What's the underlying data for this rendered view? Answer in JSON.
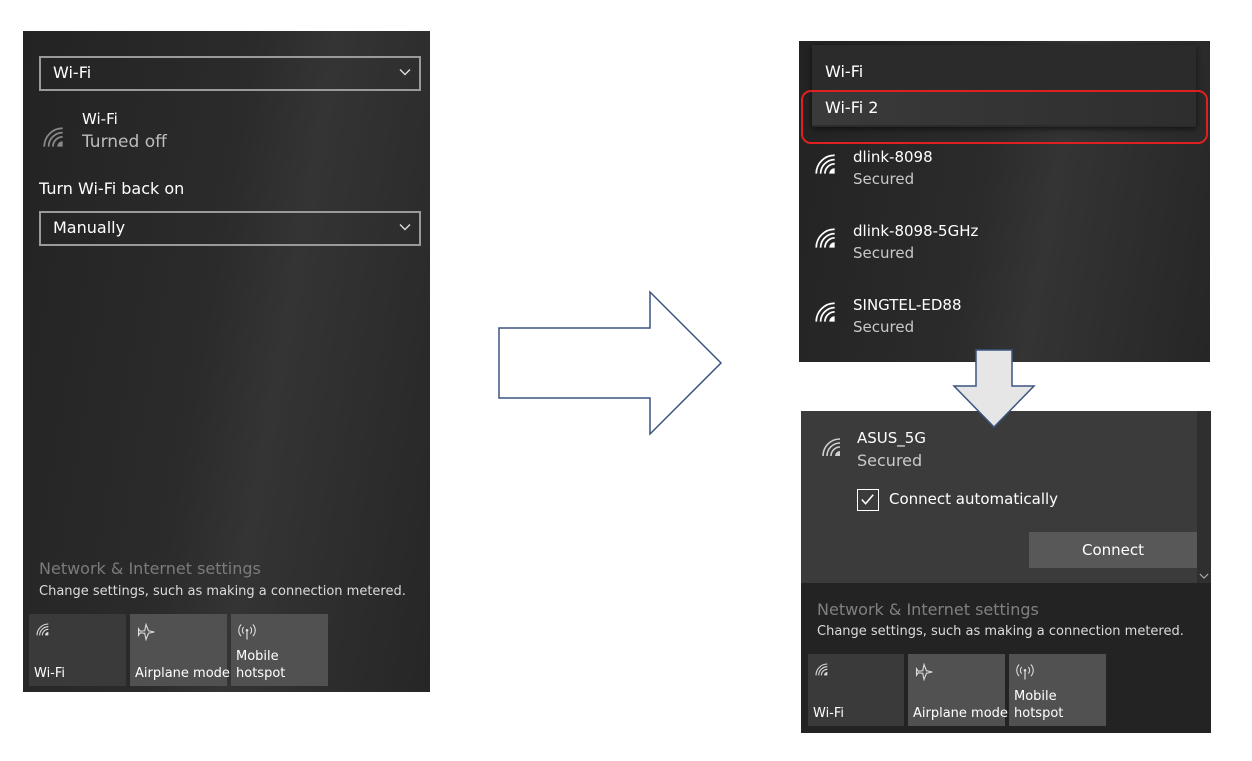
{
  "left_panel": {
    "adapter_select": "Wi-Fi",
    "wifi_status": {
      "name": "Wi-Fi",
      "state": "Turned off"
    },
    "turn_back_label": "Turn Wi-Fi back on",
    "turn_back_select": "Manually",
    "settings_link": "Network & Internet settings",
    "settings_desc": "Change settings, such as making a connection metered.",
    "tiles": [
      {
        "label": "Wi-Fi",
        "icon": "wifi-icon"
      },
      {
        "label": "Airplane mode",
        "icon": "airplane-icon"
      },
      {
        "label_line1": "Mobile",
        "label_line2": "hotspot",
        "icon": "hotspot-icon"
      }
    ]
  },
  "dropdown_panel": {
    "options": [
      "Wi-Fi",
      "Wi-Fi 2"
    ],
    "networks": [
      {
        "name": "dlink-8098",
        "status": "Secured"
      },
      {
        "name": "dlink-8098-5GHz",
        "status": "Secured"
      },
      {
        "name": "SINGTEL-ED88",
        "status": "Secured"
      }
    ],
    "highlight_color": "#e02020"
  },
  "connect_panel": {
    "network": {
      "name": "ASUS_5G",
      "status": "Secured"
    },
    "auto_connect_label": "Connect automatically",
    "auto_connect_checked": true,
    "connect_button": "Connect",
    "settings_link": "Network & Internet settings",
    "settings_desc": "Change settings, such as making a connection metered.",
    "tiles": [
      {
        "label": "Wi-Fi",
        "icon": "wifi-icon"
      },
      {
        "label": "Airplane mode",
        "icon": "airplane-icon"
      },
      {
        "label_line1": "Mobile",
        "label_line2": "hotspot",
        "icon": "hotspot-icon"
      }
    ]
  },
  "colors": {
    "panel_bg": "#2a2a2a",
    "tile_bg": "#3d3d3d",
    "tile_bg_light": "#505050",
    "arrow_stroke": "#3b5580"
  }
}
